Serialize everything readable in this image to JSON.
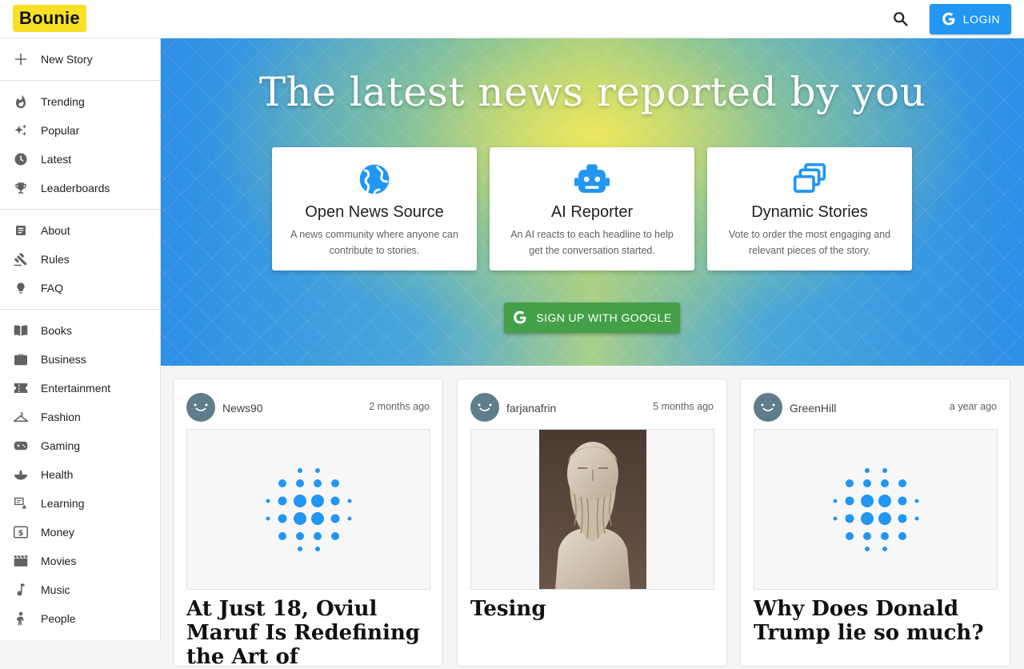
{
  "header": {
    "logo": "Bounie",
    "login_label": "LOGIN"
  },
  "sidebar": {
    "new_story": "New Story",
    "browse": [
      {
        "label": "Trending",
        "icon": "fire-icon"
      },
      {
        "label": "Popular",
        "icon": "sparkle-icon"
      },
      {
        "label": "Latest",
        "icon": "clock-icon"
      },
      {
        "label": "Leaderboards",
        "icon": "trophy-icon"
      }
    ],
    "info": [
      {
        "label": "About",
        "icon": "article-icon"
      },
      {
        "label": "Rules",
        "icon": "gavel-icon"
      },
      {
        "label": "FAQ",
        "icon": "lightbulb-icon"
      }
    ],
    "categories": [
      {
        "label": "Books",
        "icon": "book-icon"
      },
      {
        "label": "Business",
        "icon": "briefcase-icon"
      },
      {
        "label": "Entertainment",
        "icon": "ticket-icon"
      },
      {
        "label": "Fashion",
        "icon": "hanger-icon"
      },
      {
        "label": "Gaming",
        "icon": "gamepad-icon"
      },
      {
        "label": "Health",
        "icon": "health-icon"
      },
      {
        "label": "Learning",
        "icon": "learning-icon"
      },
      {
        "label": "Money",
        "icon": "money-icon"
      },
      {
        "label": "Movies",
        "icon": "movie-icon"
      },
      {
        "label": "Music",
        "icon": "music-icon"
      },
      {
        "label": "People",
        "icon": "person-icon"
      }
    ]
  },
  "hero": {
    "title": "The latest news reported by you",
    "features": [
      {
        "title": "Open News Source",
        "desc": "A news community where anyone can contribute to stories.",
        "icon": "globe-icon"
      },
      {
        "title": "AI Reporter",
        "desc": "An AI reacts to each headline to help get the conversation started.",
        "icon": "robot-icon"
      },
      {
        "title": "Dynamic Stories",
        "desc": "Vote to order the most engaging and relevant pieces of the story.",
        "icon": "layers-icon"
      }
    ],
    "signup_label": "SIGN UP WITH GOOGLE"
  },
  "stories": [
    {
      "author": "News90",
      "time": "2 months ago",
      "title": "At Just 18, Oviul Maruf Is Redefining the Art of",
      "thumb": "dots-placeholder"
    },
    {
      "author": "farjanafrin",
      "time": "5 months ago",
      "title": "Tesing",
      "thumb": "bust-photo"
    },
    {
      "author": "GreenHill",
      "time": "a year ago",
      "title": "Why Does Donald Trump lie so much?",
      "thumb": "dots-placeholder"
    }
  ],
  "colors": {
    "accent": "#2196f3",
    "logo_bg": "#f7e025",
    "signup": "#43a047"
  }
}
